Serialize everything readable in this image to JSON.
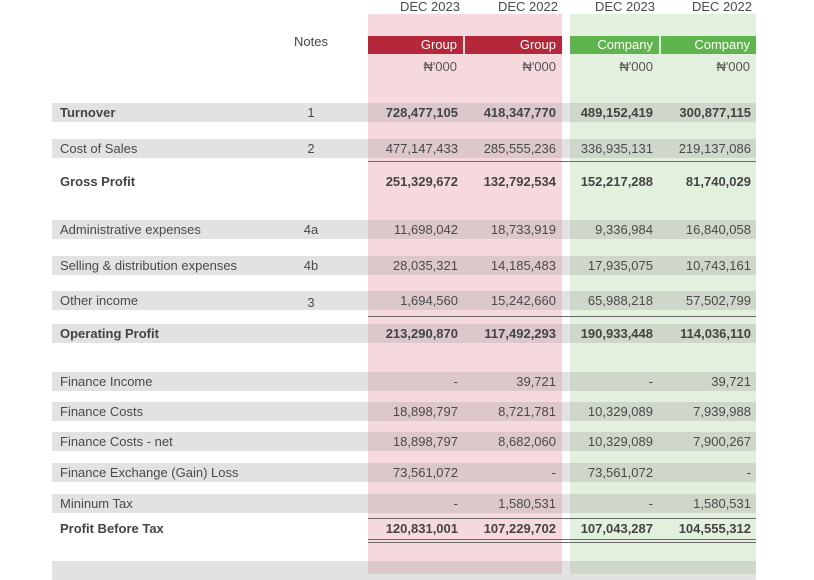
{
  "header": {
    "years": [
      "DEC 2023",
      "DEC 2022",
      "DEC 2023",
      "DEC 2022"
    ],
    "notes_label": "Notes",
    "entities": [
      "Group",
      "Group",
      "Company",
      "Company"
    ],
    "units": [
      "₦'000",
      "₦'000",
      "₦'000",
      "₦'000"
    ]
  },
  "colors": {
    "group_header": "#b5273a",
    "company_header": "#5fb54d",
    "group_band": "#f6d9dd",
    "company_band": "#e3f0dd"
  },
  "rows": [
    {
      "label": "Turnover",
      "note": "1",
      "values": [
        "728,477,105",
        "418,347,770",
        "489,152,419",
        "300,877,115"
      ]
    },
    {
      "label": "Cost of Sales",
      "note": "2",
      "values": [
        "477,147,433",
        "285,555,236",
        "336,935,131",
        "219,137,086"
      ]
    },
    {
      "label": "Gross Profit",
      "note": "",
      "values": [
        "251,329,672",
        "132,792,534",
        "152,217,288",
        "81,740,029"
      ]
    },
    {
      "label": "Administrative expenses",
      "note": "4a",
      "values": [
        "11,698,042",
        "18,733,919",
        "9,336,984",
        "16,840,058"
      ]
    },
    {
      "label": "Selling & distribution expenses",
      "note": "4b",
      "values": [
        "28,035,321",
        "14,185,483",
        "17,935,075",
        "10,743,161"
      ]
    },
    {
      "label": "Other income",
      "note": "3",
      "values": [
        "1,694,560",
        "15,242,660",
        "65,988,218",
        "57,502,799"
      ]
    },
    {
      "label": "Operating Profit",
      "note": "",
      "values": [
        "213,290,870",
        "117,492,293",
        "190,933,448",
        "114,036,110"
      ]
    },
    {
      "label": "Finance Income",
      "note": "",
      "values": [
        "-",
        "39,721",
        "-",
        "39,721"
      ]
    },
    {
      "label": "Finance Costs",
      "note": "",
      "values": [
        "18,898,797",
        "8,721,781",
        "10,329,089",
        "7,939,988"
      ]
    },
    {
      "label": "Finance Costs - net",
      "note": "",
      "values": [
        "18,898,797",
        "8,682,060",
        "10,329,089",
        "7,900,267"
      ]
    },
    {
      "label": "Finance Exchange (Gain) Loss",
      "note": "",
      "values": [
        "73,561,072",
        "-",
        "73,561,072",
        "-"
      ]
    },
    {
      "label": "Mininum Tax",
      "note": "",
      "values": [
        "-",
        "1,580,531",
        "-",
        "1,580,531"
      ]
    },
    {
      "label": "Profit Before Tax",
      "note": "",
      "values": [
        "120,831,001",
        "107,229,702",
        "107,043,287",
        "104,555,312"
      ]
    }
  ]
}
